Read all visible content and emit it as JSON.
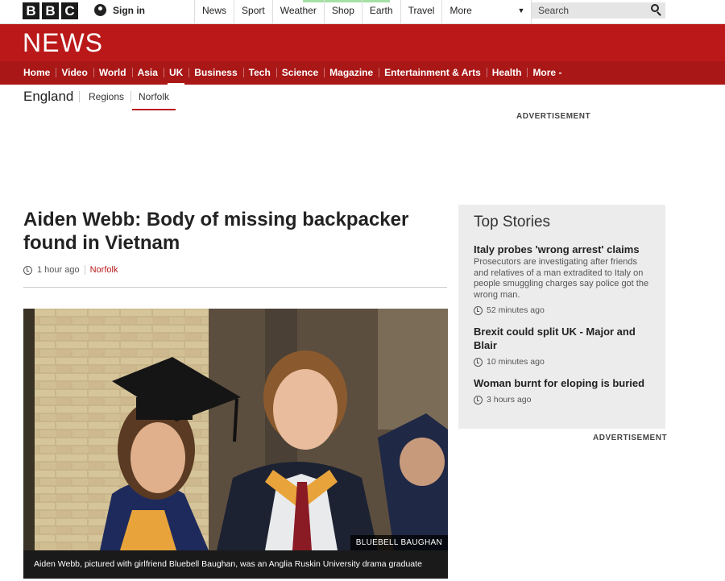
{
  "masthead": {
    "logo_letters": [
      "B",
      "B",
      "C"
    ],
    "signin_label": "Sign in",
    "nav": [
      "News",
      "Sport",
      "Weather",
      "Shop",
      "Earth",
      "Travel",
      "More"
    ],
    "search_placeholder": "Search"
  },
  "news": {
    "title": "NEWS",
    "nav": [
      "Home",
      "Video",
      "World",
      "Asia",
      "UK",
      "Business",
      "Tech",
      "Science",
      "Magazine",
      "Entertainment & Arts",
      "Health",
      "More -"
    ],
    "active": "UK"
  },
  "subnav": {
    "section": "England",
    "regions": "Regions",
    "current": "Norfolk"
  },
  "advertisement": "ADVERTISEMENT",
  "article": {
    "headline": "Aiden Webb: Body of missing backpacker found in Vietnam",
    "time": "1 hour ago",
    "tag": "Norfolk",
    "photo_credit": "BLUEBELL BAUGHAN",
    "caption": "Aiden Webb, pictured with girlfriend Bluebell Baughan, was an Anglia Ruskin University drama graduate"
  },
  "top_stories": {
    "title": "Top Stories",
    "items": [
      {
        "title": "Italy probes 'wrong arrest' claims",
        "summary": "Prosecutors are investigating after friends and relatives of a man extradited to Italy on people smuggling charges say police got the wrong man.",
        "time": "52 minutes ago"
      },
      {
        "title": "Brexit could split UK - Major and Blair",
        "summary": "",
        "time": "10 minutes ago"
      },
      {
        "title": "Woman burnt for eloping is buried",
        "summary": "",
        "time": "3 hours ago"
      }
    ]
  },
  "colors": {
    "brand_red": "#bb1919",
    "nav_red": "#a91717"
  }
}
